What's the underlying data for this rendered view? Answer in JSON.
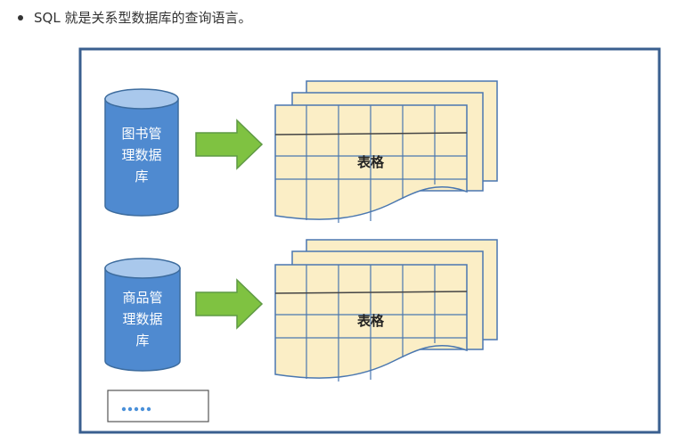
{
  "bullet": {
    "text": "SQL 就是关系型数据库的查询语言。"
  },
  "diagram": {
    "colors": {
      "frame": "#3a5f8f",
      "cylinder_body": "#4f8ad0",
      "cylinder_top": "#a9c8ec",
      "cylinder_stroke": "#3d6c9e",
      "arrow_fill": "#7fc241",
      "arrow_stroke": "#5f9a44",
      "table_fill": "#fbeec6",
      "table_grid": "#4a77b0",
      "table_header_line": "#444444",
      "ellipsis_dots": "#4a90d9"
    },
    "databases": [
      {
        "lines": [
          "图书管",
          "理数据",
          "库"
        ],
        "table_label": "表格"
      },
      {
        "lines": [
          "商品管",
          "理数据",
          "库"
        ],
        "table_label": "表格"
      }
    ],
    "more_box": {
      "dots": 5
    }
  }
}
